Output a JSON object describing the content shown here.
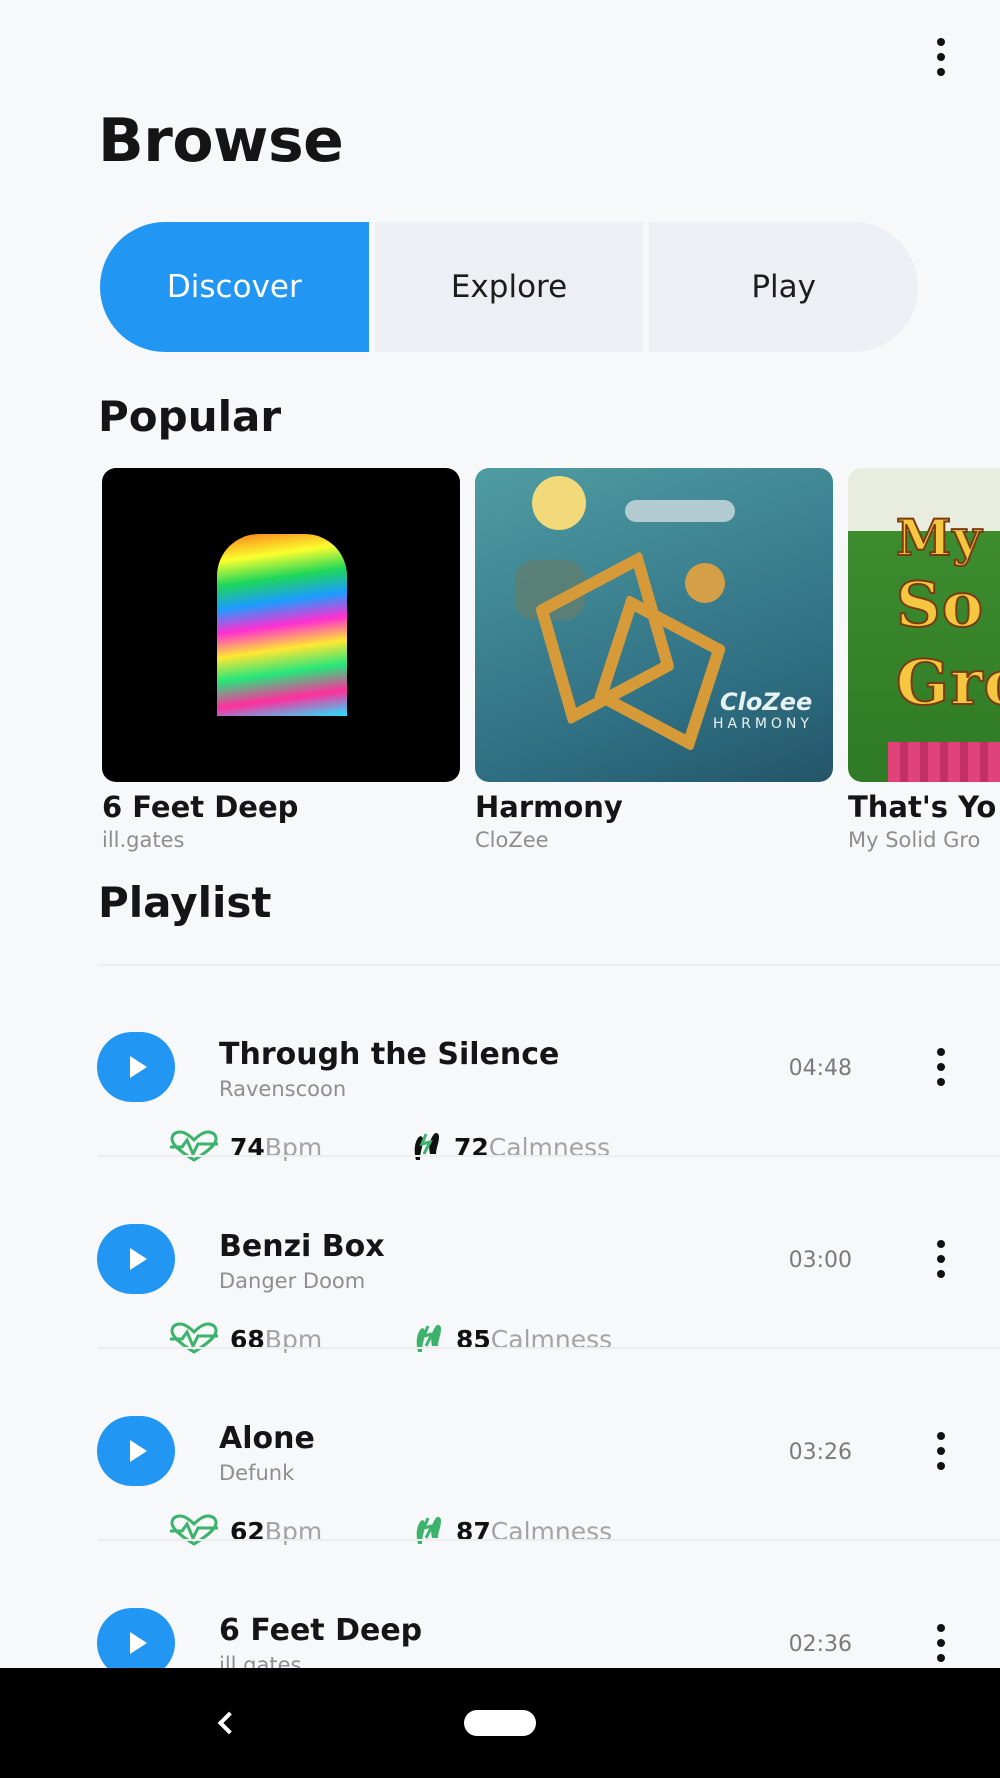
{
  "header": {
    "title": "Browse",
    "menu_icon": "more-vert-icon"
  },
  "tabs": [
    {
      "label": "Discover",
      "active": true
    },
    {
      "label": "Explore",
      "active": false
    },
    {
      "label": "Play",
      "active": false
    }
  ],
  "popular": {
    "title": "Popular",
    "albums": [
      {
        "title": "6 Feet Deep",
        "artist": "ill.gates"
      },
      {
        "title": "Harmony",
        "artist": "CloZee",
        "cover_text": "HARMONY",
        "cover_logo": "CloZee"
      },
      {
        "title": "That's Yo",
        "artist": "My Solid Gro",
        "cover_text": [
          "My",
          "So",
          "Gro"
        ]
      }
    ]
  },
  "playlist": {
    "title": "Playlist",
    "items": [
      {
        "title": "Through the Silence",
        "artist": "Ravenscoon",
        "duration": "04:48",
        "bpm": "74",
        "bpm_unit": "Bpm",
        "calmness": "72",
        "calmness_unit": "Calmness"
      },
      {
        "title": "Benzi Box",
        "artist": "Danger Doom",
        "duration": "03:00",
        "bpm": "68",
        "bpm_unit": "Bpm",
        "calmness": "85",
        "calmness_unit": "Calmness"
      },
      {
        "title": "Alone",
        "artist": "Defunk",
        "duration": "03:26",
        "bpm": "62",
        "bpm_unit": "Bpm",
        "calmness": "87",
        "calmness_unit": "Calmness"
      },
      {
        "title": "6 Feet Deep",
        "artist": "ill.gates",
        "duration": "02:36"
      }
    ]
  },
  "colors": {
    "accent": "#2196f3",
    "background": "#f7f8f9",
    "stat_icon": "#3bb36b",
    "nav_bar": "#000000"
  },
  "icons": {
    "play": "play-icon",
    "heart_rate": "heart-rate-icon",
    "calmness": "footsteps-icon",
    "back": "back-icon",
    "home": "home-pill-icon"
  }
}
